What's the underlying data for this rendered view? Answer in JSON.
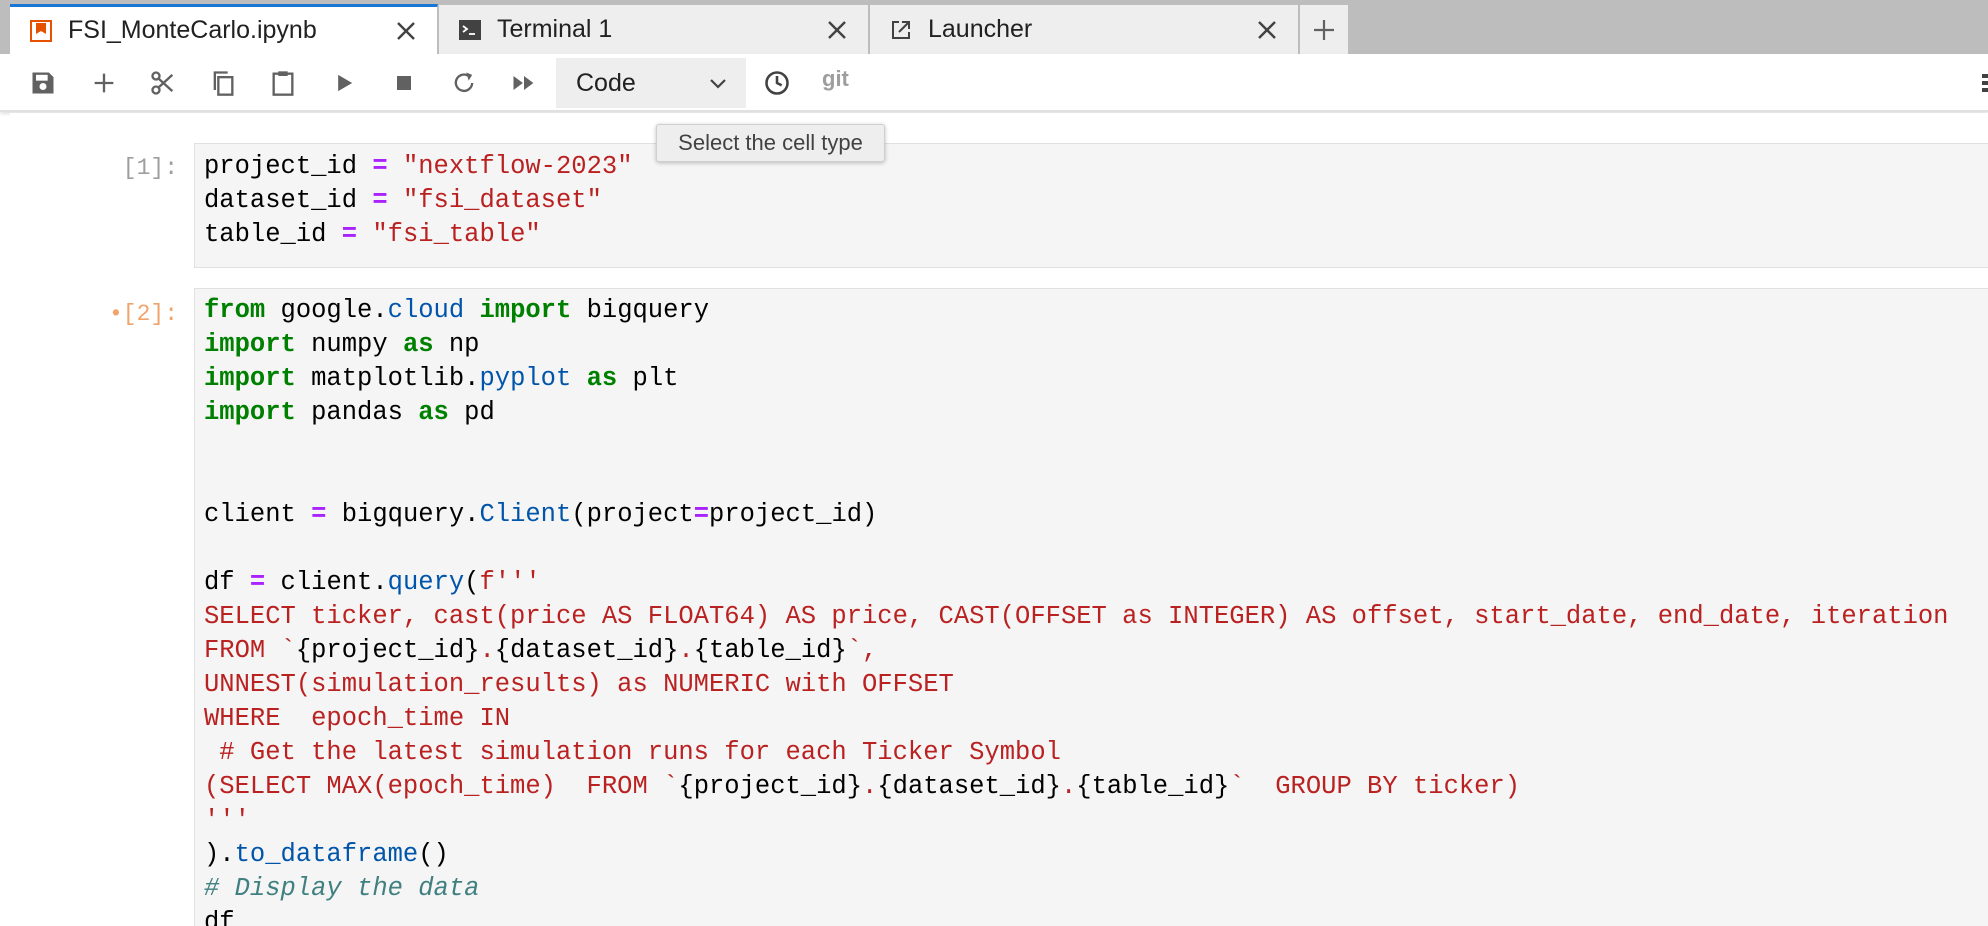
{
  "tabs": [
    {
      "label": "FSI_MonteCarlo.ipynb",
      "icon": "notebook-icon",
      "active": true
    },
    {
      "label": "Terminal 1",
      "icon": "terminal-icon",
      "active": false
    },
    {
      "label": "Launcher",
      "icon": "launcher-icon",
      "active": false
    }
  ],
  "toolbar": {
    "cell_type": "Code",
    "git_label": "git",
    "tooltip": "Select the cell type",
    "buttons": [
      "save-icon",
      "add-cell-icon",
      "cut-icon",
      "copy-icon",
      "paste-icon",
      "run-icon",
      "stop-icon",
      "restart-icon",
      "fast-forward-icon",
      "clock-icon"
    ]
  },
  "colors": {
    "accent": "#1976d2",
    "keyword": "#008000",
    "string": "#ba2121",
    "operator": "#aa22ff",
    "name": "#0055aa",
    "comment": "#408080",
    "dirty_prompt": "#f0a46c"
  },
  "cells": [
    {
      "prompt": "[1]:",
      "lines": [
        [
          [
            "",
            "project_id "
          ],
          [
            "op",
            "="
          ],
          [
            "",
            " "
          ],
          [
            "str",
            "\"nextflow-2023\""
          ]
        ],
        [
          [
            "",
            "dataset_id "
          ],
          [
            "op",
            "="
          ],
          [
            "",
            " "
          ],
          [
            "str",
            "\"fsi_dataset\""
          ]
        ],
        [
          [
            "",
            "table_id "
          ],
          [
            "op",
            "="
          ],
          [
            "",
            " "
          ],
          [
            "str",
            "\"fsi_table\""
          ]
        ]
      ]
    },
    {
      "prompt": "[2]:",
      "dirty_marker": "•",
      "lines": [
        [
          [
            "kw",
            "from"
          ],
          [
            "",
            " google."
          ],
          [
            "nm",
            "cloud"
          ],
          [
            "",
            " "
          ],
          [
            "kw",
            "import"
          ],
          [
            "",
            " bigquery"
          ]
        ],
        [
          [
            "kw",
            "import"
          ],
          [
            "",
            " numpy "
          ],
          [
            "kw",
            "as"
          ],
          [
            "",
            " np"
          ]
        ],
        [
          [
            "kw",
            "import"
          ],
          [
            "",
            " matplotlib."
          ],
          [
            "nm",
            "pyplot"
          ],
          [
            "",
            " "
          ],
          [
            "kw",
            "as"
          ],
          [
            "",
            " plt"
          ]
        ],
        [
          [
            "kw",
            "import"
          ],
          [
            "",
            " pandas "
          ],
          [
            "kw",
            "as"
          ],
          [
            "",
            " pd"
          ]
        ],
        [],
        [],
        [
          [
            "",
            "client "
          ],
          [
            "op",
            "="
          ],
          [
            "",
            " bigquery."
          ],
          [
            "nm",
            "Client"
          ],
          [
            "",
            "(project"
          ],
          [
            "op",
            "="
          ],
          [
            "",
            "project_id)"
          ]
        ],
        [],
        [
          [
            "",
            "df "
          ],
          [
            "op",
            "="
          ],
          [
            "",
            " client."
          ],
          [
            "nm",
            "query"
          ],
          [
            "",
            "("
          ],
          [
            "str",
            "f'''"
          ]
        ],
        [
          [
            "str",
            "SELECT ticker, cast(price AS FLOAT64) AS price, CAST(OFFSET as INTEGER) AS offset, start_date, end_date, iteration"
          ]
        ],
        [
          [
            "str",
            "FROM `"
          ],
          [
            "",
            "{project_id}"
          ],
          [
            "str",
            "."
          ],
          [
            "",
            "{dataset_id}"
          ],
          [
            "str",
            "."
          ],
          [
            "",
            "{table_id}"
          ],
          [
            "str",
            "`,"
          ]
        ],
        [
          [
            "str",
            "UNNEST(simulation_results) as NUMERIC with OFFSET"
          ]
        ],
        [
          [
            "str",
            "WHERE  epoch_time IN"
          ]
        ],
        [
          [
            "str",
            " # Get the latest simulation runs for each Ticker Symbol"
          ]
        ],
        [
          [
            "str",
            "(SELECT MAX(epoch_time)  FROM `"
          ],
          [
            "",
            "{project_id}"
          ],
          [
            "str",
            "."
          ],
          [
            "",
            "{dataset_id}"
          ],
          [
            "str",
            "."
          ],
          [
            "",
            "{table_id}"
          ],
          [
            "str",
            "`  GROUP BY ticker)"
          ]
        ],
        [
          [
            "str",
            "'''"
          ]
        ],
        [
          [
            "",
            ")."
          ],
          [
            "nm",
            "to_dataframe"
          ],
          [
            "",
            "()"
          ]
        ],
        [
          [
            "cm",
            "# Display the data"
          ]
        ],
        [
          [
            "",
            "df"
          ]
        ]
      ]
    }
  ]
}
